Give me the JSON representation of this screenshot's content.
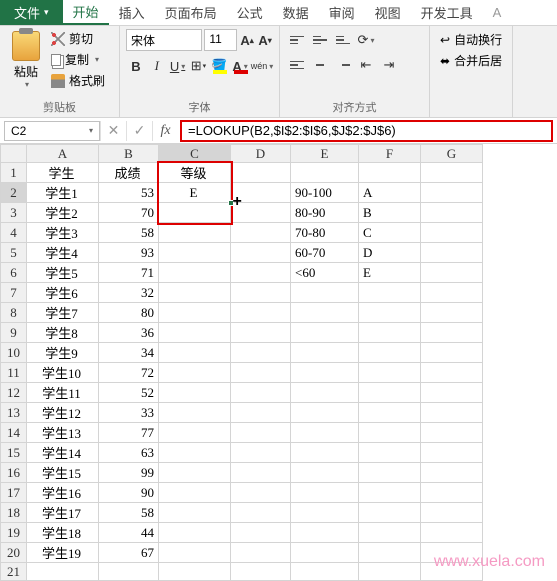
{
  "tabs": {
    "file": "文件",
    "list": [
      "开始",
      "插入",
      "页面布局",
      "公式",
      "数据",
      "审阅",
      "视图",
      "开发工具"
    ],
    "active": 0,
    "overflow": "A"
  },
  "clipboard": {
    "paste": "粘贴",
    "cut": "剪切",
    "copy": "复制",
    "format_painter": "格式刷",
    "group": "剪贴板"
  },
  "font": {
    "name": "宋体",
    "size": "11",
    "group": "字体",
    "bold": "B",
    "italic": "I",
    "underline": "U",
    "wen": "wén"
  },
  "align": {
    "group": "对齐方式",
    "wrap": "自动换行",
    "merge": "合并后居"
  },
  "formula_bar": {
    "cell_ref": "C2",
    "formula": "=LOOKUP(B2,$I$2:$I$6,$J$2:$J$6)"
  },
  "columns": [
    "A",
    "B",
    "C",
    "D",
    "E",
    "F",
    "G"
  ],
  "header_row": {
    "A": "学生",
    "B": "成绩",
    "C": "等级"
  },
  "lookup_table": [
    {
      "range": "90-100",
      "grade": "A"
    },
    {
      "range": "80-90",
      "grade": "B"
    },
    {
      "range": "70-80",
      "grade": "C"
    },
    {
      "range": "60-70",
      "grade": "D"
    },
    {
      "range": "<60",
      "grade": "E"
    }
  ],
  "c2_value": "E",
  "students": [
    {
      "name": "学生1",
      "score": 53
    },
    {
      "name": "学生2",
      "score": 70
    },
    {
      "name": "学生3",
      "score": 58
    },
    {
      "name": "学生4",
      "score": 93
    },
    {
      "name": "学生5",
      "score": 71
    },
    {
      "name": "学生6",
      "score": 32
    },
    {
      "name": "学生7",
      "score": 80
    },
    {
      "name": "学生8",
      "score": 36
    },
    {
      "name": "学生9",
      "score": 34
    },
    {
      "name": "学生10",
      "score": 72
    },
    {
      "name": "学生11",
      "score": 52
    },
    {
      "name": "学生12",
      "score": 33
    },
    {
      "name": "学生13",
      "score": 77
    },
    {
      "name": "学生14",
      "score": 63
    },
    {
      "name": "学生15",
      "score": 99
    },
    {
      "name": "学生16",
      "score": 90
    },
    {
      "name": "学生17",
      "score": 58
    },
    {
      "name": "学生18",
      "score": 44
    },
    {
      "name": "学生19",
      "score": 67
    }
  ],
  "watermark": "www.xuela.com"
}
